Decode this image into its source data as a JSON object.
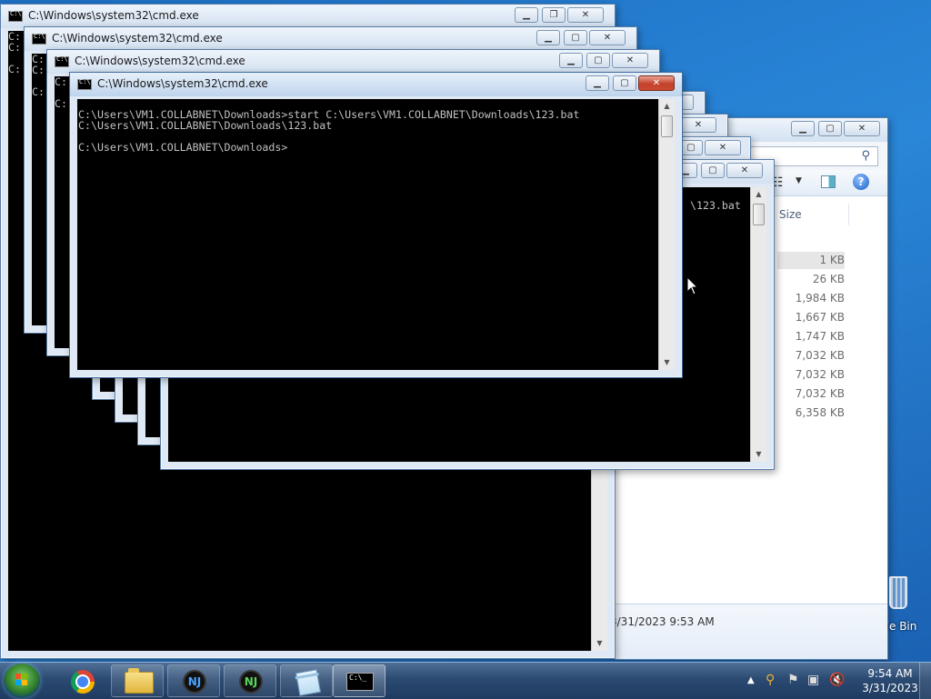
{
  "windows": {
    "title": "C:\\Windows\\system32\\cmd.exe",
    "ctrl_min": "▁",
    "ctrl_max": "▢",
    "ctrl_restore": "❐",
    "ctrl_close": "✕"
  },
  "bg_cmd1": {
    "lines": [
      "C:",
      "C:",
      "",
      "C:"
    ]
  },
  "bg_cmd2": {
    "lines": [
      "C:",
      "C:",
      "",
      "C:"
    ]
  },
  "bg_cmd3": {
    "lines": [
      "C:",
      "",
      "C:"
    ]
  },
  "front_cmd": {
    "lines": [
      "C:\\Users\\VM1.COLLABNET\\Downloads>start C:\\Users\\VM1.COLLABNET\\Downloads\\123.bat",
      "C:\\Users\\VM1.COLLABNET\\Downloads\\123.bat",
      "",
      "C:\\Users\\VM1.COLLABNET\\Downloads>"
    ]
  },
  "mid_cmd": {
    "lines": [
      "\\123.bat"
    ]
  },
  "explorer": {
    "size_header": "Size",
    "sizes": [
      "1 KB",
      "26 KB",
      "1,984 KB",
      "1,667 KB",
      "1,747 KB",
      "7,032 KB",
      "7,032 KB",
      "7,032 KB",
      "6,358 KB"
    ],
    "details_date": "3/31/2023 9:53 AM",
    "help": "?"
  },
  "desktop": {
    "recycle_bin_label": "e Bin"
  },
  "taskbar": {
    "nj1": "NJ",
    "nj2": "NJ",
    "cmd_icon_text": "C:\\_",
    "colors": {
      "nj1_text": "#4aa3ff",
      "nj2_text": "#59d65a"
    }
  },
  "tray": {
    "time": "9:54 AM",
    "date": "3/31/2023"
  }
}
